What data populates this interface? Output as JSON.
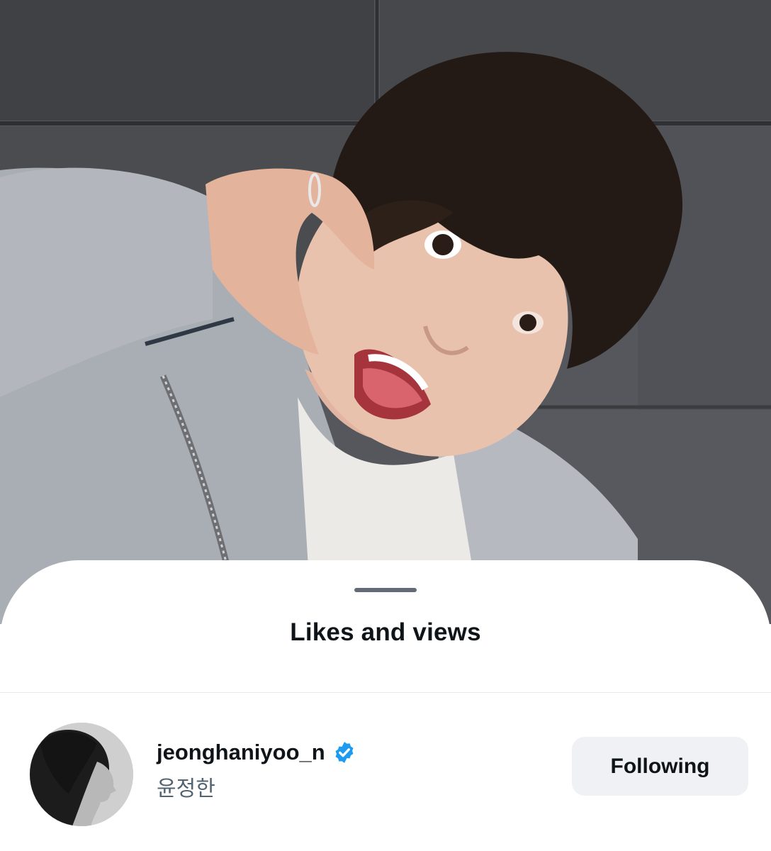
{
  "sheet": {
    "title": "Likes and views"
  },
  "user": {
    "handle": "jeonghaniyoo_n",
    "display_name": "윤정한",
    "verified": true,
    "follow_button_label": "Following"
  },
  "colors": {
    "verified_badge": "#1d9bf0",
    "button_bg": "#eff1f4",
    "text_primary": "#0f1419",
    "text_secondary": "#536471"
  },
  "icons": {
    "verified": "verified-badge-icon"
  }
}
